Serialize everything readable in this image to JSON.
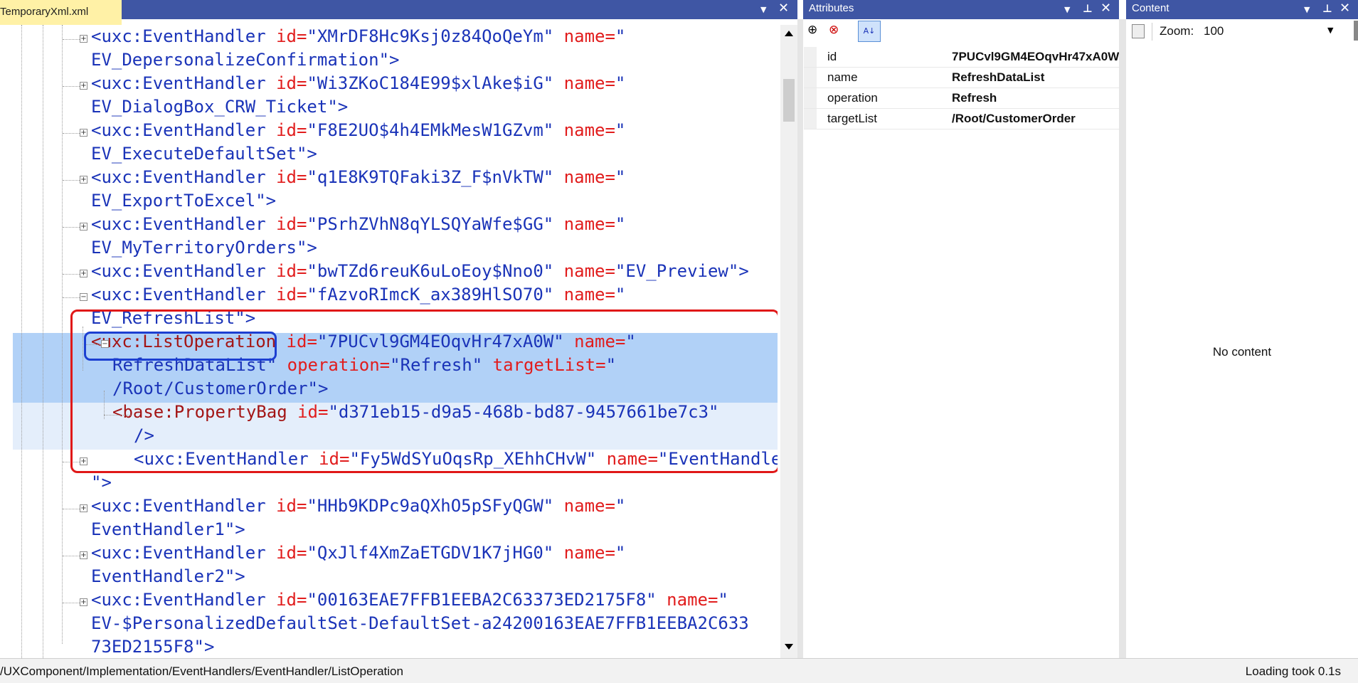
{
  "editor": {
    "tab_title": "TemporaryXml.xml",
    "lines": [
      {
        "segments": [
          {
            "t": "<uxc:EventHandler",
            "c": "b"
          },
          {
            "t": " id=",
            "c": "r"
          },
          {
            "t": "\"XMrDF8Hc9Ksj0z84QoQeYm\"",
            "c": "b"
          },
          {
            "t": " name=",
            "c": "r"
          },
          {
            "t": "\"",
            "c": "b"
          }
        ]
      },
      {
        "segments": [
          {
            "t": "EV_DepersonalizeConfirmation\">",
            "c": "b"
          }
        ]
      },
      {
        "segments": [
          {
            "t": "<uxc:EventHandler",
            "c": "b"
          },
          {
            "t": " id=",
            "c": "r"
          },
          {
            "t": "\"Wi3ZKoC184E99$xlAke$iG\"",
            "c": "b"
          },
          {
            "t": " name=",
            "c": "r"
          },
          {
            "t": "\"",
            "c": "b"
          }
        ]
      },
      {
        "segments": [
          {
            "t": "EV_DialogBox_CRW_Ticket\">",
            "c": "b"
          }
        ]
      },
      {
        "segments": [
          {
            "t": "<uxc:EventHandler",
            "c": "b"
          },
          {
            "t": " id=",
            "c": "r"
          },
          {
            "t": "\"F8E2UO$4h4EMkMesW1GZvm\"",
            "c": "b"
          },
          {
            "t": " name=",
            "c": "r"
          },
          {
            "t": "\"",
            "c": "b"
          }
        ]
      },
      {
        "segments": [
          {
            "t": "EV_ExecuteDefaultSet\">",
            "c": "b"
          }
        ]
      },
      {
        "segments": [
          {
            "t": "<uxc:EventHandler",
            "c": "b"
          },
          {
            "t": " id=",
            "c": "r"
          },
          {
            "t": "\"q1E8K9TQFaki3Z_F$nVkTW\"",
            "c": "b"
          },
          {
            "t": " name=",
            "c": "r"
          },
          {
            "t": "\"",
            "c": "b"
          }
        ]
      },
      {
        "segments": [
          {
            "t": "EV_ExportToExcel\">",
            "c": "b"
          }
        ]
      },
      {
        "segments": [
          {
            "t": "<uxc:EventHandler",
            "c": "b"
          },
          {
            "t": " id=",
            "c": "r"
          },
          {
            "t": "\"PSrhZVhN8qYLSQYaWfe$GG\"",
            "c": "b"
          },
          {
            "t": " name=",
            "c": "r"
          },
          {
            "t": "\"",
            "c": "b"
          }
        ]
      },
      {
        "segments": [
          {
            "t": "EV_MyTerritoryOrders\">",
            "c": "b"
          }
        ]
      },
      {
        "segments": [
          {
            "t": "<uxc:EventHandler",
            "c": "b"
          },
          {
            "t": " id=",
            "c": "r"
          },
          {
            "t": "\"bwTZd6reuK6uLoEoy$Nno0\"",
            "c": "b"
          },
          {
            "t": " name=",
            "c": "r"
          },
          {
            "t": "\"EV_Preview\">",
            "c": "b"
          }
        ]
      },
      {
        "segments": [
          {
            "t": "<uxc:EventHandler",
            "c": "b"
          },
          {
            "t": " id=",
            "c": "r"
          },
          {
            "t": "\"fAzvoRImcK_ax389HlSO70\"",
            "c": "b"
          },
          {
            "t": " name=",
            "c": "r"
          },
          {
            "t": "\"",
            "c": "b"
          }
        ]
      },
      {
        "segments": [
          {
            "t": "EV_RefreshList\">",
            "c": "b"
          }
        ]
      },
      {
        "segments": [
          {
            "t": "<uxc:ListOperation",
            "c": "k"
          },
          {
            "t": " id=",
            "c": "r"
          },
          {
            "t": "\"7PUCvl9GM4EOqvHr47xA0W\"",
            "c": "b"
          },
          {
            "t": " name=",
            "c": "r"
          },
          {
            "t": "\"",
            "c": "b"
          }
        ]
      },
      {
        "segments": [
          {
            "t": "RefreshDataList\"",
            "c": "b"
          },
          {
            "t": " operation=",
            "c": "r"
          },
          {
            "t": "\"Refresh\"",
            "c": "b"
          },
          {
            "t": " targetList=",
            "c": "r"
          },
          {
            "t": "\"",
            "c": "b"
          }
        ]
      },
      {
        "segments": [
          {
            "t": "/Root/CustomerOrder\">",
            "c": "b"
          }
        ]
      },
      {
        "segments": [
          {
            "t": "<base:PropertyBag",
            "c": "k"
          },
          {
            "t": " id=",
            "c": "r"
          },
          {
            "t": "\"d371eb15-d9a5-468b-bd87-9457661be7c3\"",
            "c": "b"
          }
        ]
      },
      {
        "segments": [
          {
            "t": "/>",
            "c": "b"
          }
        ]
      },
      {
        "segments": [
          {
            "t": "<uxc:EventHandler",
            "c": "b"
          },
          {
            "t": " id=",
            "c": "r"
          },
          {
            "t": "\"Fy5WdSYuOqsRp_XEhhCHvW\"",
            "c": "b"
          },
          {
            "t": " name=",
            "c": "r"
          },
          {
            "t": "\"EventHandler",
            "c": "b"
          }
        ]
      },
      {
        "segments": [
          {
            "t": "\">",
            "c": "b"
          }
        ]
      },
      {
        "segments": [
          {
            "t": "<uxc:EventHandler",
            "c": "b"
          },
          {
            "t": " id=",
            "c": "r"
          },
          {
            "t": "\"HHb9KDPc9aQXhO5pSFyQGW\"",
            "c": "b"
          },
          {
            "t": " name=",
            "c": "r"
          },
          {
            "t": "\"",
            "c": "b"
          }
        ]
      },
      {
        "segments": [
          {
            "t": "EventHandler1\">",
            "c": "b"
          }
        ]
      },
      {
        "segments": [
          {
            "t": "<uxc:EventHandler",
            "c": "b"
          },
          {
            "t": " id=",
            "c": "r"
          },
          {
            "t": "\"QxJlf4XmZaETGDV1K7jHG0\"",
            "c": "b"
          },
          {
            "t": " name=",
            "c": "r"
          },
          {
            "t": "\"",
            "c": "b"
          }
        ]
      },
      {
        "segments": [
          {
            "t": "EventHandler2\">",
            "c": "b"
          }
        ]
      },
      {
        "segments": [
          {
            "t": "<uxc:EventHandler",
            "c": "b"
          },
          {
            "t": " id=",
            "c": "r"
          },
          {
            "t": "\"00163EAE7FFB1EEBA2C63373ED2175F8\"",
            "c": "b"
          },
          {
            "t": " name=",
            "c": "r"
          },
          {
            "t": "\"",
            "c": "b"
          }
        ]
      },
      {
        "segments": [
          {
            "t": "EV-$PersonalizedDefaultSet-DefaultSet-a24200163EAE7FFB1EEBA2C633",
            "c": "b"
          }
        ]
      },
      {
        "segments": [
          {
            "t": "73ED2155F8\">",
            "c": "b"
          }
        ]
      }
    ],
    "expanders": [
      "+",
      "+",
      "+",
      "+",
      "+",
      "+",
      "−",
      "−",
      "+",
      "+",
      "+",
      "+"
    ]
  },
  "attributes": {
    "title": "Attributes",
    "rows": [
      {
        "name": "id",
        "value": "7PUCvl9GM4EOqvHr47xA0W"
      },
      {
        "name": "name",
        "value": "RefreshDataList"
      },
      {
        "name": "operation",
        "value": "Refresh"
      },
      {
        "name": "targetList",
        "value": "/Root/CustomerOrder"
      }
    ]
  },
  "content": {
    "title": "Content",
    "zoom_label": "Zoom:",
    "zoom_value": "100",
    "empty_text": "No content"
  },
  "status": {
    "path": "/UXComponent/Implementation/EventHandlers/EventHandler/ListOperation",
    "timing": "Loading took 0.1s"
  },
  "colors": {
    "header": "#3f56a4",
    "tab": "#fff1a6",
    "selection": "#b1d1f7",
    "highlight_red": "#e01818",
    "highlight_blue": "#1c3fd1"
  },
  "icons": [
    "dropdown-icon",
    "close-icon",
    "pin-icon",
    "add-attribute-icon",
    "remove-attribute-icon",
    "sort-alpha-icon",
    "content-page-icon",
    "chevron-down-icon"
  ]
}
